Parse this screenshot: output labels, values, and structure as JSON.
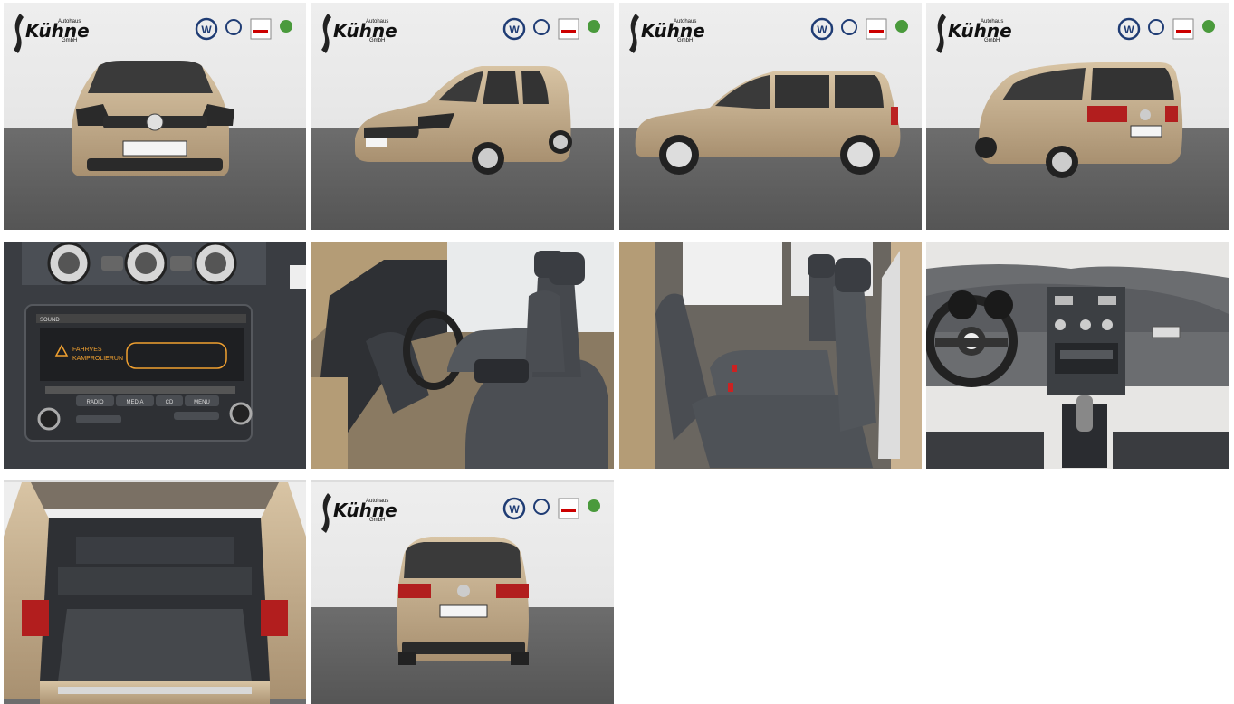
{
  "dealer": {
    "name": "Kühne",
    "line1": "Autohaus",
    "line2": "GmbH"
  },
  "brand_badges": [
    "vw-logo",
    "vw-commercial-logo",
    "audi-service-badge",
    "skoda-logo"
  ],
  "radio": {
    "warning_line1": "FAHRVES",
    "warning_line2": "KAMPROLIERUN",
    "buttons": [
      "RADIO",
      "MEDIA",
      "CD",
      "MENU"
    ],
    "top_label": "SOUND"
  },
  "car_color": "#c9b291",
  "gallery": [
    {
      "view": "front"
    },
    {
      "view": "front-three-quarter"
    },
    {
      "view": "side"
    },
    {
      "view": "rear-three-quarter"
    },
    {
      "view": "radio-console"
    },
    {
      "view": "front-seats"
    },
    {
      "view": "rear-seats"
    },
    {
      "view": "dashboard"
    },
    {
      "view": "trunk"
    },
    {
      "view": "rear"
    }
  ]
}
